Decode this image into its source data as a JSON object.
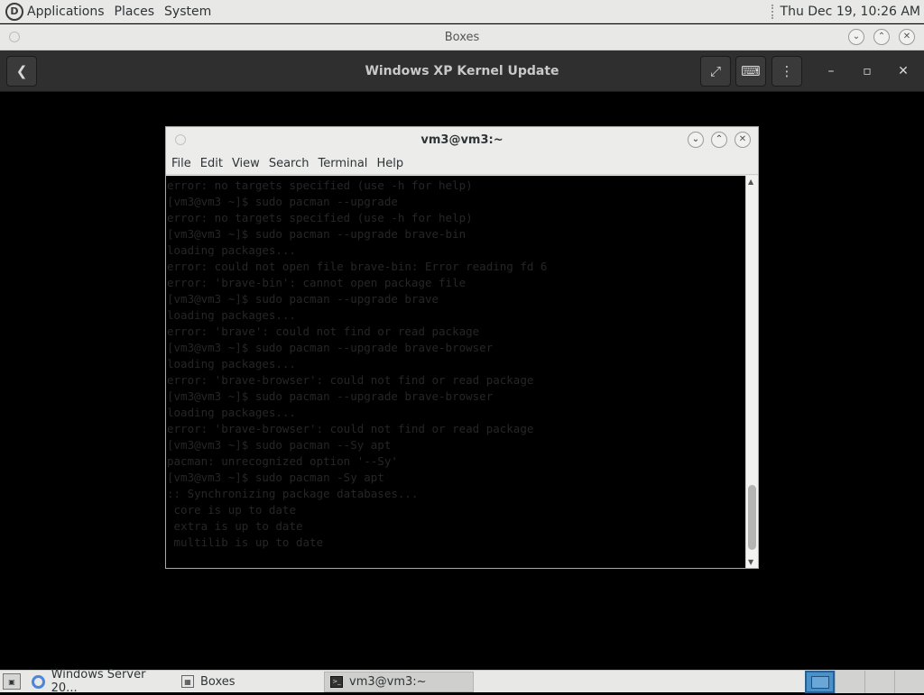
{
  "top_panel": {
    "menus": [
      "Applications",
      "Places",
      "System"
    ],
    "clock": "Thu Dec 19, 10:26 AM"
  },
  "boxes_window": {
    "title": "Boxes",
    "header_title": "Windows XP Kernel Update"
  },
  "terminal": {
    "title": "vm3@vm3:~",
    "menus": [
      "File",
      "Edit",
      "View",
      "Search",
      "Terminal",
      "Help"
    ],
    "lines": [
      "error: no targets specified (use -h for help)",
      "[vm3@vm3 ~]$ sudo pacman --upgrade",
      "error: no targets specified (use -h for help)",
      "[vm3@vm3 ~]$ sudo pacman --upgrade brave-bin",
      "loading packages...",
      "error: could not open file brave-bin: Error reading fd 6",
      "error: 'brave-bin': cannot open package file",
      "[vm3@vm3 ~]$ sudo pacman --upgrade brave",
      "loading packages...",
      "error: 'brave': could not find or read package",
      "[vm3@vm3 ~]$ sudo pacman --upgrade brave-browser",
      "loading packages...",
      "error: 'brave-browser': could not find or read package",
      "[vm3@vm3 ~]$ sudo pacman --upgrade brave-browser",
      "loading packages...",
      "error: 'brave-browser': could not find or read package",
      "[vm3@vm3 ~]$ sudo pacman --Sy apt",
      "pacman: unrecognized option '--Sy'",
      "[vm3@vm3 ~]$ sudo pacman -Sy apt",
      ":: Synchronizing package databases...",
      " core is up to date",
      " extra is up to date",
      " multilib is up to date"
    ]
  },
  "taskbar": {
    "tasks": [
      "Windows Server 20...",
      "Boxes",
      "vm3@vm3:~"
    ]
  }
}
